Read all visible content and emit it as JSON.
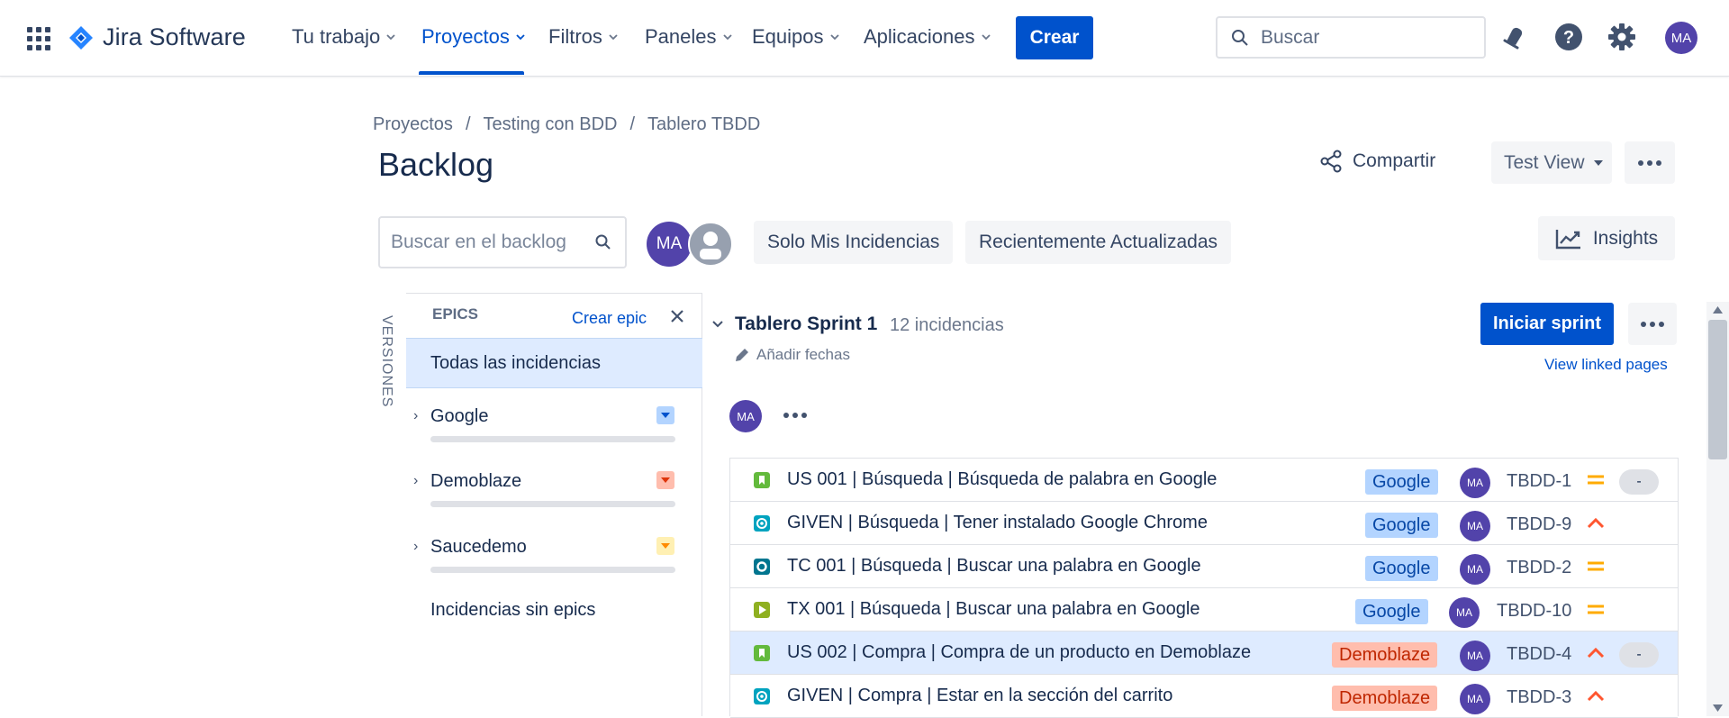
{
  "nav": {
    "app_name": "Jira Software",
    "items": [
      {
        "label": "Tu trabajo"
      },
      {
        "label": "Proyectos"
      },
      {
        "label": "Filtros"
      },
      {
        "label": "Paneles"
      },
      {
        "label": "Equipos"
      },
      {
        "label": "Aplicaciones"
      }
    ],
    "active_item": "Proyectos",
    "create_label": "Crear",
    "search_placeholder": "Buscar",
    "icons": [
      "app-switcher-icon",
      "notifications-icon",
      "help-icon",
      "settings-icon"
    ],
    "user_initials": "MA"
  },
  "breadcrumb": [
    "Proyectos",
    "Testing con BDD",
    "Tablero TBDD"
  ],
  "page": {
    "title": "Backlog",
    "share_label": "Compartir",
    "view_label": "Test View",
    "insights_label": "Insights"
  },
  "filters": {
    "search_placeholder": "Buscar en el backlog",
    "avatar_initials": "MA",
    "chips": [
      "Solo Mis Incidencias",
      "Recientemente Actualizadas"
    ]
  },
  "side": {
    "versions_label": "VERSIONES",
    "epics_title": "EPICS",
    "create_epic": "Crear epic",
    "all_issues": "Todas las incidencias",
    "epics": [
      {
        "name": "Google",
        "color": "#4c9aff"
      },
      {
        "name": "Demoblaze",
        "color": "#ff8f73"
      },
      {
        "name": "Saucedemo",
        "color": "#ffc400"
      }
    ],
    "no_epics": "Incidencias sin epics"
  },
  "sprint": {
    "name": "Tablero Sprint 1",
    "count": "12 incidencias",
    "add_dates": "Añadir fechas",
    "start_label": "Iniciar sprint",
    "linked_pages": "View linked pages",
    "avatar_initials": "MA",
    "issues": [
      {
        "type": "story",
        "summary": "US 001 | Búsqueda | Búsqueda de palabra en Google",
        "epic": "Google",
        "assignee": "MA",
        "key": "TBDD-1",
        "priority": "medium",
        "estimate": "-"
      },
      {
        "type": "given",
        "summary": "GIVEN | Búsqueda | Tener instalado Google Chrome",
        "epic": "Google",
        "assignee": "MA",
        "key": "TBDD-9",
        "priority": "high",
        "estimate": ""
      },
      {
        "type": "testcase",
        "summary": "TC 001 | Búsqueda | Buscar una palabra en Google",
        "epic": "Google",
        "assignee": "MA",
        "key": "TBDD-2",
        "priority": "medium",
        "estimate": ""
      },
      {
        "type": "execution",
        "summary": "TX 001 | Búsqueda | Buscar una palabra en Google",
        "epic": "Google",
        "assignee": "MA",
        "key": "TBDD-10",
        "priority": "medium",
        "estimate": ""
      },
      {
        "type": "story",
        "summary": "US 002 | Compra | Compra de un producto en Demoblaze",
        "epic": "Demoblaze",
        "assignee": "MA",
        "key": "TBDD-4",
        "priority": "high",
        "estimate": "-"
      },
      {
        "type": "given",
        "summary": "GIVEN | Compra | Estar en la sección del carrito",
        "epic": "Demoblaze",
        "assignee": "MA",
        "key": "TBDD-3",
        "priority": "high",
        "estimate": ""
      }
    ]
  },
  "colors": {
    "brand": "#0052cc",
    "selected_row": "#deebff",
    "epic_google_bg": "#b3d4ff",
    "epic_demoblaze_bg": "#ffbdad",
    "priority_medium": "#ffab00",
    "priority_high": "#ff5630"
  }
}
